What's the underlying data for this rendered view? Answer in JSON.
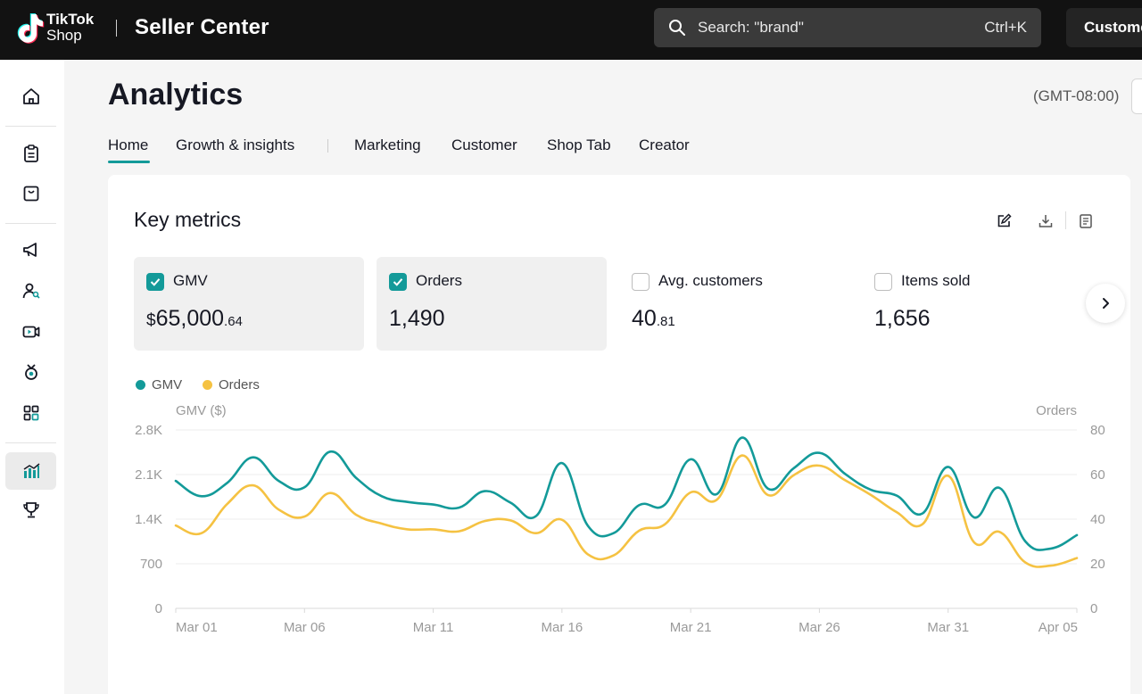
{
  "topbar": {
    "brand_line1": "TikTok",
    "brand_line2": "Shop",
    "app_title": "Seller Center",
    "search_placeholder": "Search: \"brand\"",
    "search_shortcut": "Ctrl+K",
    "customer_button": "Customer"
  },
  "sidebar": {
    "items": [
      {
        "icon": "home-icon"
      },
      {
        "icon": "orders-icon"
      },
      {
        "icon": "products-icon"
      },
      {
        "icon": "marketing-icon"
      },
      {
        "icon": "customers-icon"
      },
      {
        "icon": "live-video-icon"
      },
      {
        "icon": "creator-icon"
      },
      {
        "icon": "apps-icon"
      },
      {
        "icon": "analytics-icon",
        "active": true
      },
      {
        "icon": "trophy-icon"
      }
    ]
  },
  "page": {
    "title": "Analytics",
    "timezone": "(GMT-08:00)",
    "tabs": [
      "Home",
      "Growth & insights",
      "Marketing",
      "Customer",
      "Shop Tab",
      "Creator"
    ],
    "active_tab": "Home"
  },
  "key_metrics": {
    "title": "Key metrics",
    "metrics": [
      {
        "label": "GMV",
        "checked": true,
        "currency": "$",
        "value_main": "65,000",
        "value_decimal": ".64"
      },
      {
        "label": "Orders",
        "checked": true,
        "currency": "",
        "value_main": "1,490",
        "value_decimal": ""
      },
      {
        "label": "Avg. customers",
        "checked": false,
        "currency": "",
        "value_main": "40",
        "value_decimal": ".81"
      },
      {
        "label": "Items sold",
        "checked": false,
        "currency": "",
        "value_main": "1,656",
        "value_decimal": ""
      }
    ]
  },
  "chart_data": {
    "type": "line",
    "legend": [
      "GMV",
      "Orders"
    ],
    "legend_placement": "top-left",
    "left_axis_label": "GMV ($)",
    "right_axis_label": "Orders",
    "left_ticks": [
      "0",
      "700",
      "1.4K",
      "2.1K",
      "2.8K"
    ],
    "right_ticks": [
      "0",
      "20",
      "40",
      "60",
      "80"
    ],
    "ylim_left": [
      0,
      2800
    ],
    "ylim_right": [
      0,
      80
    ],
    "x_ticks": [
      "Mar 01",
      "Mar 06",
      "Mar 11",
      "Mar 16",
      "Mar 21",
      "Mar 26",
      "Mar 31",
      "Apr 05"
    ],
    "grid": true,
    "colors": {
      "GMV": "#139a99",
      "Orders": "#f5c242"
    },
    "x": [
      "Mar 01",
      "Mar 02",
      "Mar 03",
      "Mar 04",
      "Mar 05",
      "Mar 06",
      "Mar 07",
      "Mar 08",
      "Mar 09",
      "Mar 10",
      "Mar 11",
      "Mar 12",
      "Mar 13",
      "Mar 14",
      "Mar 15",
      "Mar 16",
      "Mar 17",
      "Mar 18",
      "Mar 19",
      "Mar 20",
      "Mar 21",
      "Mar 22",
      "Mar 23",
      "Mar 24",
      "Mar 25",
      "Mar 26",
      "Mar 27",
      "Mar 28",
      "Mar 29",
      "Mar 30",
      "Mar 31",
      "Apr 01",
      "Apr 02",
      "Apr 03",
      "Apr 04",
      "Apr 05"
    ],
    "series": [
      {
        "name": "GMV",
        "axis": "left",
        "values": [
          2000,
          1760,
          1970,
          2370,
          2000,
          1900,
          2460,
          2050,
          1760,
          1670,
          1630,
          1580,
          1840,
          1660,
          1450,
          2280,
          1300,
          1180,
          1620,
          1630,
          2340,
          1790,
          2680,
          1880,
          2200,
          2440,
          2110,
          1860,
          1770,
          1490,
          2220,
          1430,
          1890,
          1050,
          940,
          1150
        ]
      },
      {
        "name": "Orders",
        "axis": "left",
        "values": [
          1300,
          1180,
          1640,
          1930,
          1550,
          1440,
          1810,
          1470,
          1330,
          1240,
          1240,
          1210,
          1370,
          1380,
          1180,
          1390,
          850,
          830,
          1220,
          1320,
          1820,
          1700,
          2400,
          1780,
          2090,
          2240,
          2010,
          1780,
          1510,
          1320,
          2080,
          1040,
          1200,
          720,
          670,
          790
        ]
      }
    ]
  }
}
